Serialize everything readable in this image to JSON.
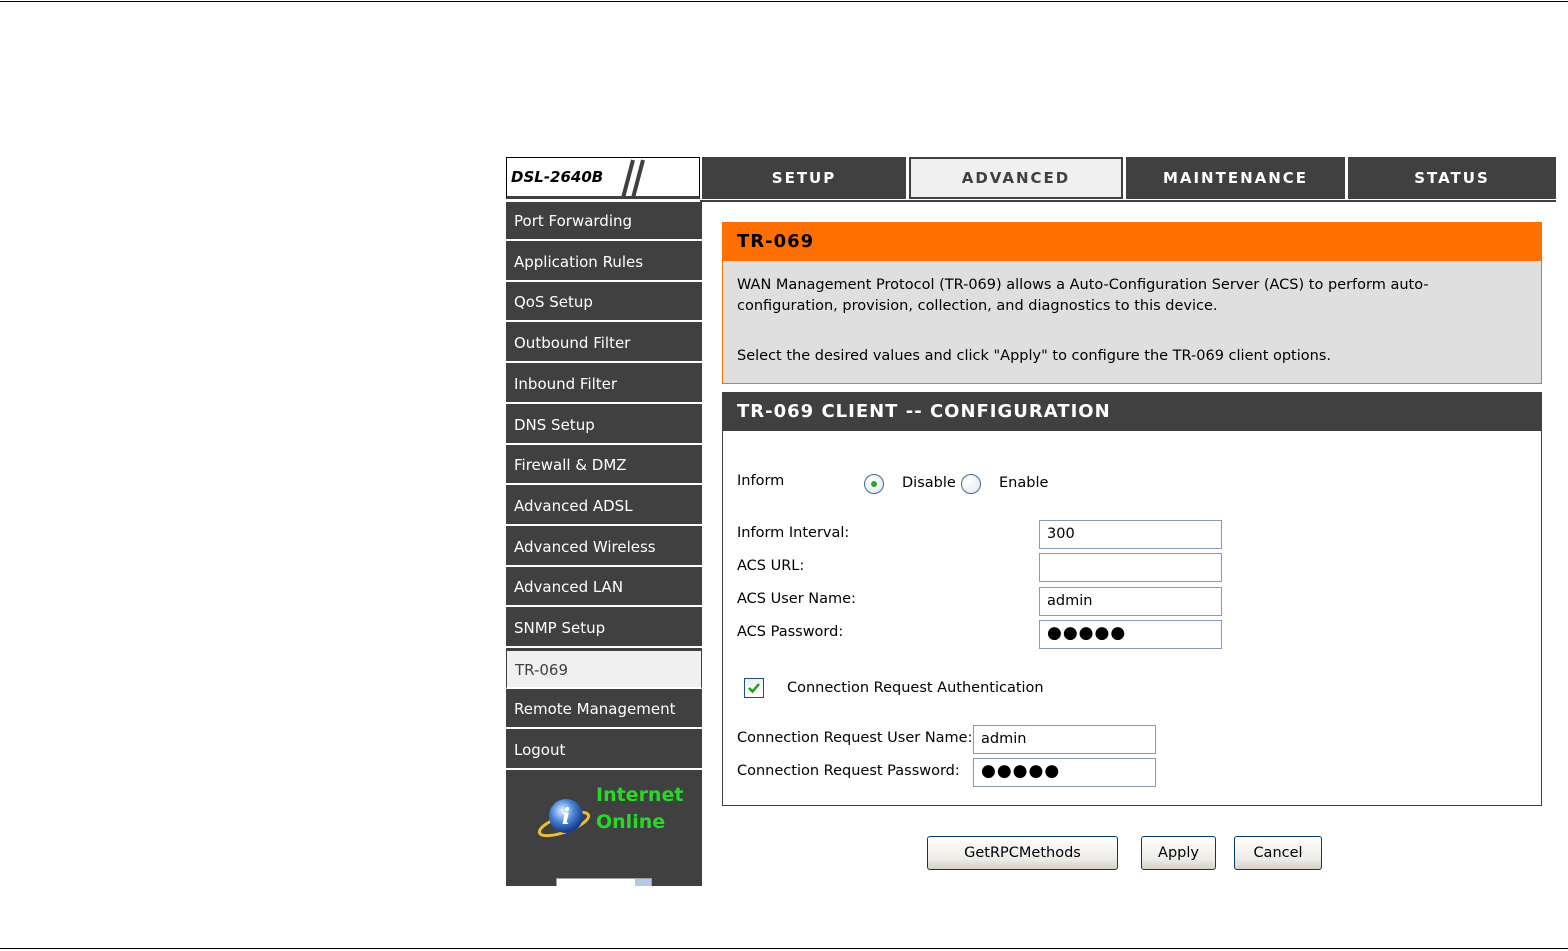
{
  "brand": {
    "model": "DSL-2640B"
  },
  "nav": {
    "tabs": [
      {
        "label": "SETUP"
      },
      {
        "label": "ADVANCED"
      },
      {
        "label": "MAINTENANCE"
      },
      {
        "label": "STATUS"
      }
    ],
    "active_tab": "ADVANCED"
  },
  "sidebar": {
    "items": [
      {
        "label": "Port Forwarding"
      },
      {
        "label": "Application Rules"
      },
      {
        "label": "QoS Setup"
      },
      {
        "label": "Outbound Filter"
      },
      {
        "label": "Inbound Filter"
      },
      {
        "label": "DNS Setup"
      },
      {
        "label": "Firewall & DMZ"
      },
      {
        "label": "Advanced ADSL"
      },
      {
        "label": "Advanced Wireless"
      },
      {
        "label": "Advanced LAN"
      },
      {
        "label": "SNMP Setup"
      },
      {
        "label": "TR-069"
      },
      {
        "label": "Remote Management"
      },
      {
        "label": "Logout"
      }
    ],
    "active_item": "TR-069",
    "status": {
      "line1": "Internet",
      "line2": "Online",
      "color": "#2bd62b",
      "icon": "info-globe-icon"
    }
  },
  "info": {
    "title": "TR-069",
    "description": "WAN Management Protocol (TR-069) allows a Auto-Configuration Server (ACS) to perform auto-configuration, provision, collection, and diagnostics to this device.",
    "instruction": "Select the desired values and click \"Apply\" to configure the TR-069 client options."
  },
  "config": {
    "title": "TR-069 CLIENT -- CONFIGURATION",
    "inform": {
      "label": "Inform",
      "options": [
        {
          "label": "Disable",
          "selected": true
        },
        {
          "label": "Enable",
          "selected": false
        }
      ]
    },
    "inform_interval": {
      "label": "Inform Interval:",
      "value": "300"
    },
    "acs_url": {
      "label": "ACS URL:",
      "value": ""
    },
    "acs_user": {
      "label": "ACS User Name:",
      "value": "admin"
    },
    "acs_password": {
      "label": "ACS Password:",
      "value": "●●●●●"
    },
    "conn_auth": {
      "label": "Connection Request Authentication",
      "checked": true
    },
    "conn_user": {
      "label": "Connection Request User Name:",
      "value": "admin"
    },
    "conn_password": {
      "label": "Connection Request Password:",
      "value": "●●●●●"
    }
  },
  "buttons": {
    "getrpc": "GetRPCMethods",
    "apply": "Apply",
    "cancel": "Cancel"
  },
  "colors": {
    "accent_orange": "#ff6f00",
    "dark_gray": "#404040",
    "panel_gray": "#dfdfdf",
    "status_green": "#2bd62b"
  }
}
